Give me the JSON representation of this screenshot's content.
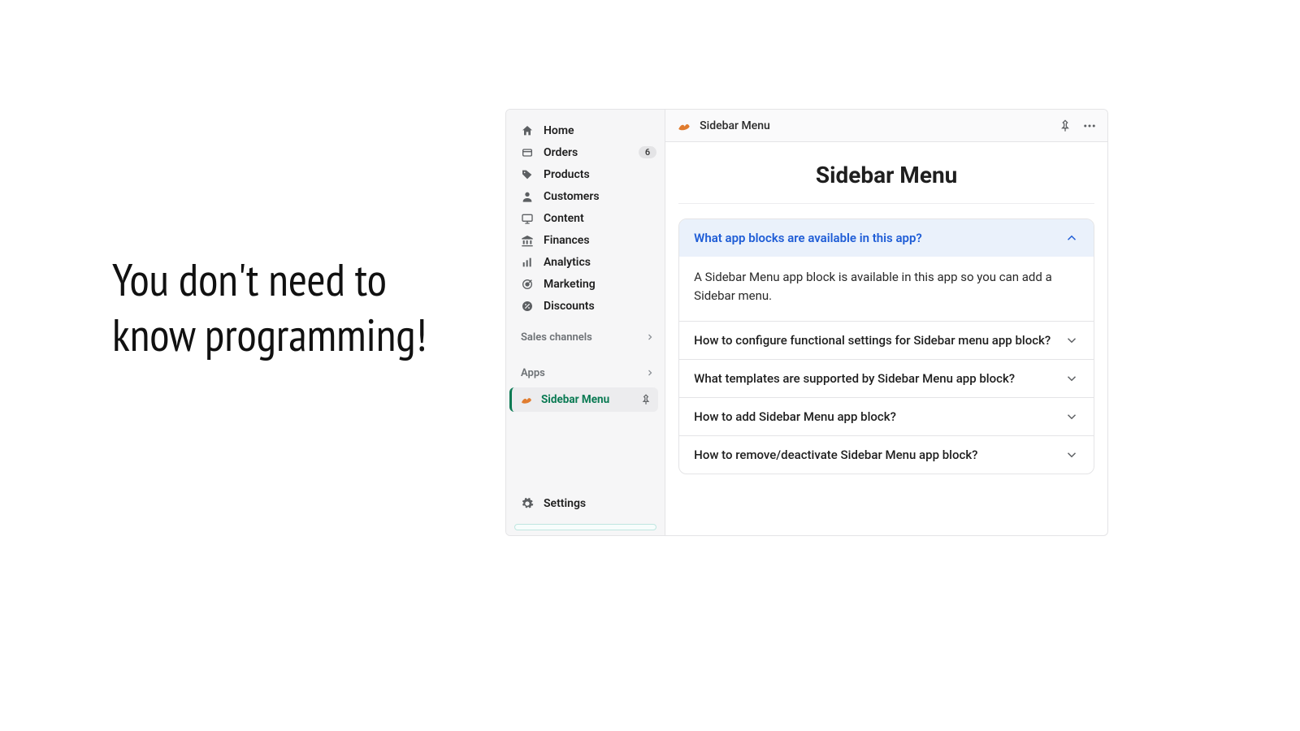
{
  "promo": {
    "line1": "You don't need to",
    "line2": "know programming!"
  },
  "sidebar": {
    "nav": [
      {
        "icon": "home",
        "label": "Home",
        "badge": null
      },
      {
        "icon": "orders",
        "label": "Orders",
        "badge": "6"
      },
      {
        "icon": "products",
        "label": "Products",
        "badge": null
      },
      {
        "icon": "customers",
        "label": "Customers",
        "badge": null
      },
      {
        "icon": "content",
        "label": "Content",
        "badge": null
      },
      {
        "icon": "finances",
        "label": "Finances",
        "badge": null
      },
      {
        "icon": "analytics",
        "label": "Analytics",
        "badge": null
      },
      {
        "icon": "marketing",
        "label": "Marketing",
        "badge": null
      },
      {
        "icon": "discounts",
        "label": "Discounts",
        "badge": null
      }
    ],
    "sections": {
      "sales_channels": "Sales channels",
      "apps": "Apps"
    },
    "active_app": "Sidebar Menu",
    "settings": "Settings"
  },
  "main": {
    "header_title": "Sidebar Menu",
    "page_title": "Sidebar Menu",
    "faq": [
      {
        "question": "What app blocks are available in this app?",
        "answer": "A Sidebar Menu app block is available in this app so you can add a Sidebar menu.",
        "open": true
      },
      {
        "question": "How to configure functional settings for Sidebar menu app block?",
        "answer": "",
        "open": false
      },
      {
        "question": "What templates are supported by Sidebar Menu app block?",
        "answer": "",
        "open": false
      },
      {
        "question": "How to add Sidebar Menu app block?",
        "answer": "",
        "open": false
      },
      {
        "question": "How to remove/deactivate Sidebar Menu app block?",
        "answer": "",
        "open": false
      }
    ]
  }
}
